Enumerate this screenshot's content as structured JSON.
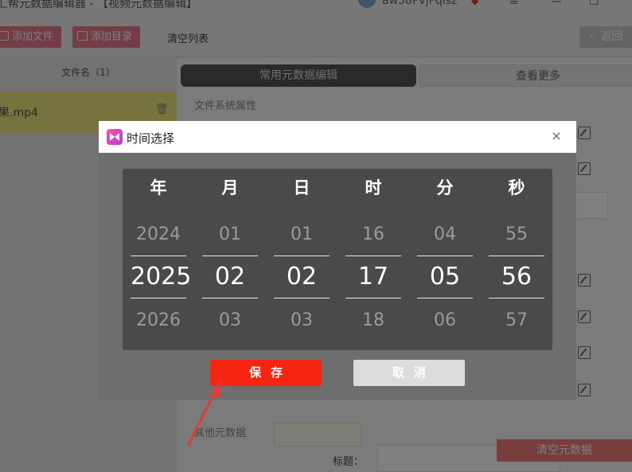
{
  "app": {
    "title": "汇帮元数据编辑器 - 【视频元数据编辑】",
    "user_name": "aw38PvjPqlsz",
    "win_min": "—",
    "win_max": "☐",
    "win_menu": "≡"
  },
  "toolbar": {
    "add_file": "添加文件",
    "add_dir": "添加目录",
    "clear_list": "清空列表",
    "back": "返回"
  },
  "file_list": {
    "header": "文件名（1）",
    "items": [
      {
        "name": "果.mp4"
      }
    ]
  },
  "tabs": {
    "common": "常用元数据编辑",
    "more": "查看更多"
  },
  "labels": {
    "fs_props": "文件系统属性",
    "other_meta": "其他元数据",
    "title_field": "标题：",
    "clear_meta": "清空元数据"
  },
  "dialog": {
    "title": "时间选择",
    "close": "×",
    "columns": [
      {
        "head": "年",
        "prev": "2024",
        "current": "2025",
        "next": "2026"
      },
      {
        "head": "月",
        "prev": "01",
        "current": "02",
        "next": "03"
      },
      {
        "head": "日",
        "prev": "01",
        "current": "02",
        "next": "03"
      },
      {
        "head": "时",
        "prev": "16",
        "current": "17",
        "next": "18"
      },
      {
        "head": "分",
        "prev": "04",
        "current": "05",
        "next": "06"
      },
      {
        "head": "秒",
        "prev": "55",
        "current": "56",
        "next": "57"
      }
    ],
    "save": "保存",
    "cancel": "取消"
  },
  "colors": {
    "accent_red": "#f52512",
    "button_pink": "#e8798c",
    "selected_row": "#efe77e",
    "annotation_arrow": "#e53935"
  }
}
